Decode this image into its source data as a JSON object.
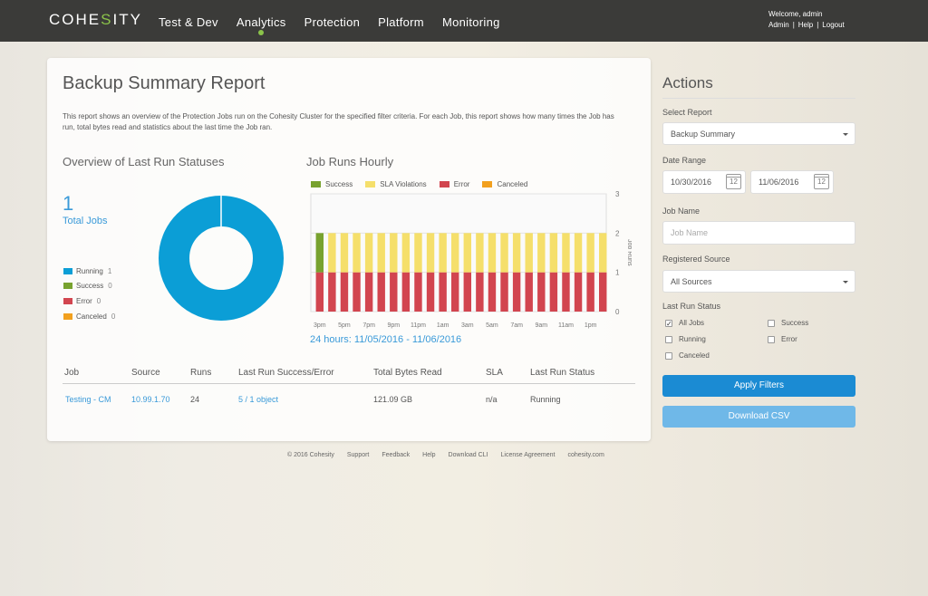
{
  "colors": {
    "topbar": "#3b3b39",
    "accent": "#1b8bd3",
    "link": "#3a9ad9",
    "running": "#0b9ed6",
    "success": "#78a22f",
    "sla": "#f5df6b",
    "error": "#d2454f",
    "canceled": "#f2a01e"
  },
  "header": {
    "logo": "COHESITY",
    "nav": [
      "Test & Dev",
      "Analytics",
      "Protection",
      "Platform",
      "Monitoring"
    ],
    "active_nav": "Analytics",
    "welcome": "Welcome, admin",
    "links": [
      "Admin",
      "Help",
      "Logout"
    ]
  },
  "report": {
    "title": "Backup Summary Report",
    "description": "This report shows an overview of the Protection Jobs run on the Cohesity Cluster for the specified filter criteria. For each Job, this report shows how many times the Job has run, total bytes read and statistics about the last time the Job ran.",
    "overview_title": "Overview of Last Run Statuses",
    "total_count": "1",
    "total_label": "Total Jobs",
    "status_legend": [
      {
        "label": "Running",
        "count": "1",
        "color": "#0b9ed6"
      },
      {
        "label": "Success",
        "count": "0",
        "color": "#78a22f"
      },
      {
        "label": "Error",
        "count": "0",
        "color": "#d2454f"
      },
      {
        "label": "Canceled",
        "count": "0",
        "color": "#f2a01e"
      }
    ],
    "hourly_title": "Job Runs Hourly",
    "range_label": "24 hours: 11/05/2016 - 11/06/2016"
  },
  "chart_data": [
    {
      "type": "pie",
      "title": "Overview of Last Run Statuses",
      "categories": [
        "Running",
        "Success",
        "Error",
        "Canceled"
      ],
      "values": [
        1,
        0,
        0,
        0
      ]
    },
    {
      "type": "bar",
      "title": "Job Runs Hourly",
      "ylabel": "Job Runs",
      "ylim": [
        0,
        3
      ],
      "yticks": [
        "0",
        "1",
        "2",
        "3"
      ],
      "xticks": [
        "3pm",
        "5pm",
        "7pm",
        "9pm",
        "11pm",
        "1am",
        "3am",
        "5am",
        "7am",
        "9am",
        "11am",
        "1pm"
      ],
      "bars": 24,
      "stacked": true,
      "series": [
        {
          "name": "Success",
          "color": "#78a22f",
          "values": [
            1,
            0,
            0,
            0,
            0,
            0,
            0,
            0,
            0,
            0,
            0,
            0,
            0,
            0,
            0,
            0,
            0,
            0,
            0,
            0,
            0,
            0,
            0,
            0
          ]
        },
        {
          "name": "SLA Violations",
          "color": "#f5df6b",
          "values": [
            0,
            1,
            1,
            1,
            1,
            1,
            1,
            1,
            1,
            1,
            1,
            1,
            1,
            1,
            1,
            1,
            1,
            1,
            1,
            1,
            1,
            1,
            1,
            1
          ]
        },
        {
          "name": "Error",
          "color": "#d2454f",
          "values": [
            1,
            1,
            1,
            1,
            1,
            1,
            1,
            1,
            1,
            1,
            1,
            1,
            1,
            1,
            1,
            1,
            1,
            1,
            1,
            1,
            1,
            1,
            1,
            1
          ]
        },
        {
          "name": "Canceled",
          "color": "#f2a01e",
          "values": [
            0,
            0,
            0,
            0,
            0,
            0,
            0,
            0,
            0,
            0,
            0,
            0,
            0,
            0,
            0,
            0,
            0,
            0,
            0,
            0,
            0,
            0,
            0,
            0
          ]
        }
      ],
      "legend": "top-left"
    }
  ],
  "table": {
    "headers": [
      "Job",
      "Source",
      "Runs",
      "Last Run Success/Error",
      "Total Bytes Read",
      "SLA",
      "Last Run Status"
    ],
    "rows": [
      [
        "Testing - CM",
        "10.99.1.70",
        "24",
        "5 / 1 object",
        "121.09 GB",
        "n/a",
        "Running"
      ]
    ]
  },
  "footer": [
    "© 2016 Cohesity",
    "Support",
    "Feedback",
    "Help",
    "Download CLI",
    "License Agreement",
    "cohesity.com"
  ],
  "actions": {
    "title": "Actions",
    "select_report_label": "Select Report",
    "select_report_value": "Backup Summary",
    "date_range_label": "Date Range",
    "date_from": "10/30/2016",
    "date_to": "11/06/2016",
    "calendar_day": "12",
    "job_name_label": "Job Name",
    "job_name_placeholder": "Job Name",
    "registered_source_label": "Registered Source",
    "registered_source_value": "All Sources",
    "last_run_status_label": "Last Run Status",
    "status_options": [
      {
        "label": "All Jobs",
        "checked": true
      },
      {
        "label": "Success",
        "checked": false
      },
      {
        "label": "Running",
        "checked": false
      },
      {
        "label": "Error",
        "checked": false
      },
      {
        "label": "Canceled",
        "checked": false
      }
    ],
    "apply_label": "Apply Filters",
    "download_label": "Download CSV"
  }
}
